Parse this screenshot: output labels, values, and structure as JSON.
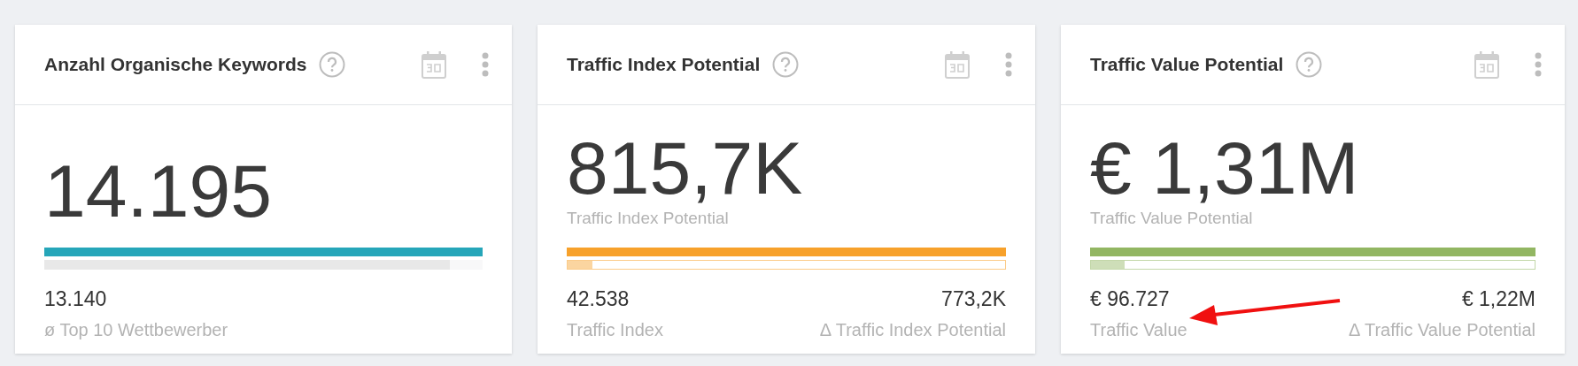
{
  "cards": [
    {
      "title": "Anzahl Organische Keywords",
      "value": "14.195",
      "color": "#26a6b9",
      "compare_bar": {
        "kind": "plain",
        "level": 0.925
      },
      "left_stat": {
        "value": "13.140",
        "label": "ø Top 10 Wettbewerber"
      }
    },
    {
      "title": "Traffic Index Potential",
      "value": "815,7K",
      "value_label": "Traffic Index Potential",
      "color": "#f7a12b",
      "compare_bar": {
        "kind": "outlined",
        "level": 0.056
      },
      "left_stat": {
        "value": "42.538",
        "label": "Traffic Index"
      },
      "right_stat": {
        "value": "773,2K",
        "label": "Δ Traffic Index Potential"
      }
    },
    {
      "title": "Traffic Value Potential",
      "value": "€ 1,31M",
      "value_label": "Traffic Value Potential",
      "color": "#92b662",
      "compare_bar": {
        "kind": "outlined",
        "level": 0.075
      },
      "left_stat": {
        "value": "€ 96.727",
        "label": "Traffic Value"
      },
      "right_stat": {
        "value": "€ 1,22M",
        "label": "Δ Traffic Value Potential"
      },
      "annotation": {
        "kind": "arrow"
      }
    }
  ]
}
